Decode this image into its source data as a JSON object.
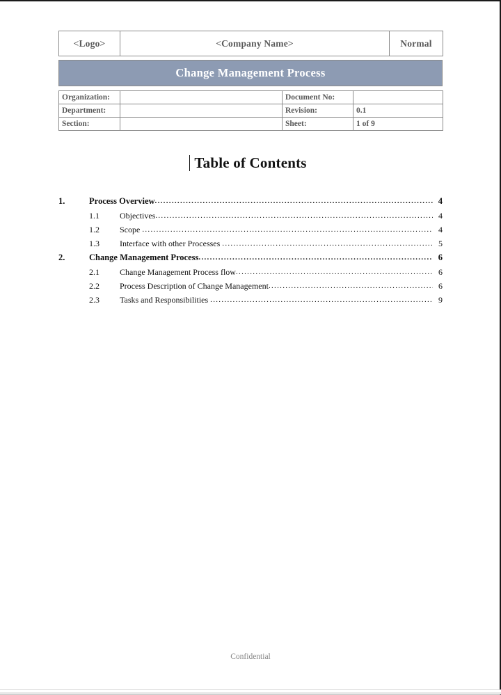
{
  "header": {
    "logo_cell": "<Logo>",
    "company_cell": "<Company Name>",
    "status_cell": "Normal",
    "banner_title": "Change Management Process"
  },
  "meta": {
    "rows": [
      {
        "label_left": "Organization:",
        "value_left": "",
        "label_right": "Document No:",
        "value_right": ""
      },
      {
        "label_left": "Department:",
        "value_left": "",
        "label_right": "Revision:",
        "value_right": "0.1"
      },
      {
        "label_left": "Section:",
        "value_left": "",
        "label_right": "Sheet:",
        "value_right": "1 of 9"
      }
    ]
  },
  "toc": {
    "title": "Table of Contents",
    "entries": [
      {
        "level": 1,
        "number": "1.",
        "label": "Process Overview",
        "page": "4"
      },
      {
        "level": 2,
        "number": "1.1",
        "label": "Objectives",
        "page": "4"
      },
      {
        "level": 2,
        "number": "1.2",
        "label": "Scope ",
        "page": "4"
      },
      {
        "level": 2,
        "number": "1.3",
        "label": "Interface with other Processes ",
        "page": "5"
      },
      {
        "level": 1,
        "number": "2.",
        "label": "Change Management Process",
        "page": "6"
      },
      {
        "level": 2,
        "number": "2.1",
        "label": "Change Management Process flow",
        "page": "6"
      },
      {
        "level": 2,
        "number": "2.2",
        "label": "Process Description of Change Management",
        "page": "6"
      },
      {
        "level": 2,
        "number": "2.3",
        "label": "Tasks and Responsibilities ",
        "page": "9"
      }
    ]
  },
  "footer": {
    "text": "Confidential"
  },
  "colors": {
    "banner_background": "#8d9bb3",
    "banner_text": "#ffffff",
    "table_border": "#8a8a8a",
    "header_text": "#595959",
    "body_text": "#111111",
    "footer_text": "#848484",
    "page_border": "#1a1a1a"
  }
}
